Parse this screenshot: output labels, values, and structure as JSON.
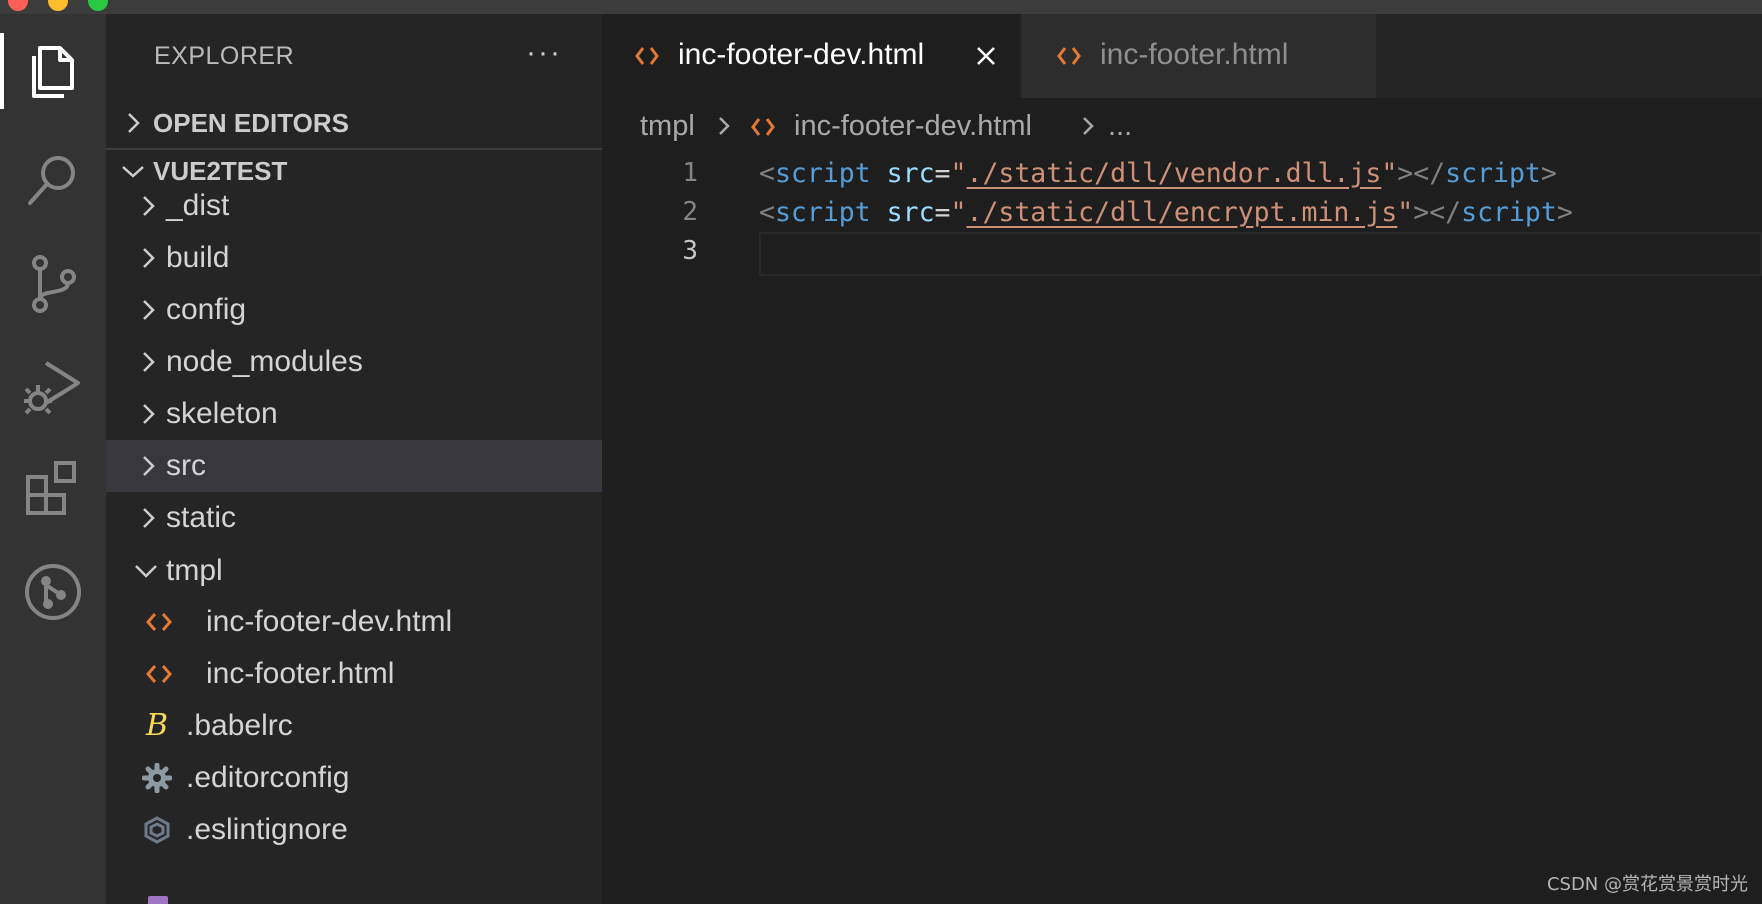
{
  "sidebar": {
    "title": "EXPLORER",
    "more_label": "···",
    "open_editors_label": "OPEN EDITORS",
    "project_label": "VUE2TEST",
    "tree": [
      {
        "name": "_dist",
        "kind": "folder",
        "expanded": false
      },
      {
        "name": "build",
        "kind": "folder",
        "expanded": false
      },
      {
        "name": "config",
        "kind": "folder",
        "expanded": false
      },
      {
        "name": "node_modules",
        "kind": "folder",
        "expanded": false
      },
      {
        "name": "skeleton",
        "kind": "folder",
        "expanded": false
      },
      {
        "name": "src",
        "kind": "folder",
        "expanded": false,
        "selected": true
      },
      {
        "name": "static",
        "kind": "folder",
        "expanded": false
      },
      {
        "name": "tmpl",
        "kind": "folder",
        "expanded": true
      },
      {
        "name": "inc-footer-dev.html",
        "kind": "html-file",
        "icon": "html-icon"
      },
      {
        "name": "inc-footer.html",
        "kind": "html-file",
        "icon": "html-icon"
      },
      {
        "name": ".babelrc",
        "kind": "file",
        "icon": "babel-icon"
      },
      {
        "name": ".editorconfig",
        "kind": "file",
        "icon": "gear-icon"
      },
      {
        "name": ".eslintignore",
        "kind": "file",
        "icon": "eslint-icon"
      }
    ]
  },
  "tabs": [
    {
      "label": "inc-footer-dev.html",
      "active": true,
      "icon": "html-icon"
    },
    {
      "label": "inc-footer.html",
      "active": false,
      "icon": "html-icon"
    }
  ],
  "breadcrumb": {
    "folder": "tmpl",
    "file": "inc-footer-dev.html",
    "more": "..."
  },
  "editor": {
    "lines": [
      {
        "number": "1",
        "open": "<",
        "tag": "script",
        "attr": "src",
        "eq": "=",
        "q1": "\"",
        "path": "./static/dll/vendor.dll.js",
        "q2": "\"",
        "close": "></",
        "tag2": "script",
        "end": ">"
      },
      {
        "number": "2",
        "open": "<",
        "tag": "script",
        "attr": "src",
        "eq": "=",
        "q1": "\"",
        "path": "./static/dll/encrypt.min.js",
        "q2": "\"",
        "close": "></",
        "tag2": "script",
        "end": ">"
      },
      {
        "number": "3"
      }
    ]
  },
  "watermark": "CSDN @赏花赏景赏时光",
  "colors": {
    "activity_bar": "#333333",
    "sidebar": "#252526",
    "editor": "#1e1e1e",
    "html_icon": "#e37933",
    "tag": "#569cd6",
    "attribute": "#9cdcfe",
    "string": "#ce9178"
  }
}
